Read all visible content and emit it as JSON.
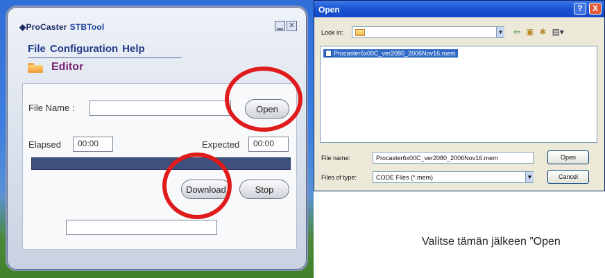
{
  "app": {
    "brand": "ProCaster",
    "tool": "STBTool",
    "menu": [
      "File",
      "Configuration",
      "Help"
    ],
    "section": "Editor",
    "file_name_label": "File Name :",
    "file_name_value": "",
    "open_button": "Open",
    "elapsed_label": "Elapsed",
    "elapsed_value": "00:00",
    "expected_label": "Expected",
    "expected_value": "00:00",
    "download_button": "Download",
    "stop_button": "Stop",
    "status_value": ""
  },
  "dialog": {
    "title": "Open",
    "help_glyph": "?",
    "close_glyph": "X",
    "look_in_label": "Look in:",
    "look_in_value": "",
    "files": [
      "Procaster6x00C_ver2080_2006Nov16.mem"
    ],
    "file_name_label": "File name:",
    "file_name_value": "Procaster6x00C_ver2080_2006Nov16.mem",
    "files_of_type_label": "Files of type:",
    "files_of_type_value": "CODE Files (*.mem)",
    "open_button": "Open",
    "cancel_button": "Cancel"
  },
  "caption": "Valitse tämän jälkeen ”Open",
  "colors": {
    "highlight_ring": "#e01b1b",
    "progress_bar": "#3f4f7e",
    "title_bar": "#1852d4"
  },
  "icons": [
    "folder-icon",
    "back-arrow-icon",
    "up-folder-icon",
    "new-folder-icon",
    "view-menu-icon",
    "file-icon"
  ]
}
